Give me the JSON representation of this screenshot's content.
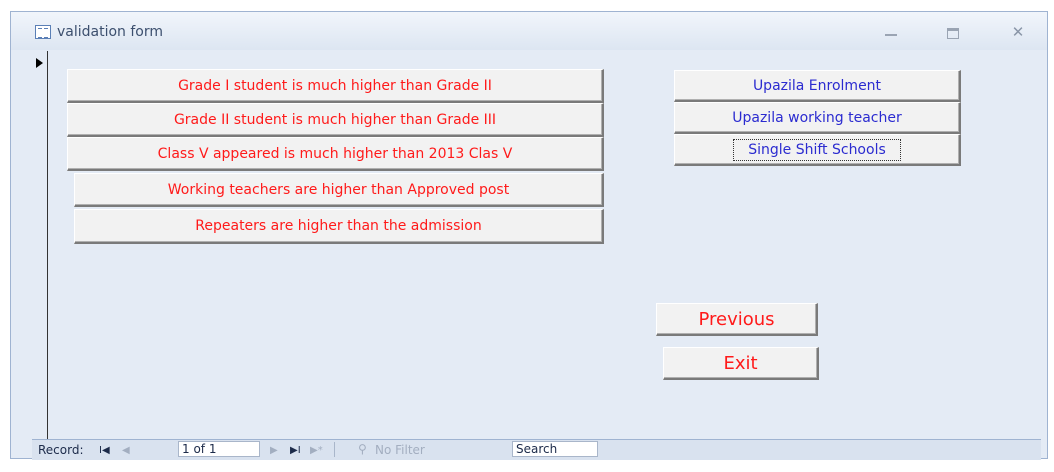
{
  "window": {
    "title": "validation form"
  },
  "left_buttons": [
    {
      "label": "Grade I student is much higher than Grade II"
    },
    {
      "label": "Grade II student is much higher than Grade III"
    },
    {
      "label": "Class V appeared is much higher than 2013 Clas V"
    },
    {
      "label": "Working teachers are higher than Approved post"
    },
    {
      "label": "Repeaters are higher than the admission"
    }
  ],
  "right_buttons": [
    {
      "label": "Upazila Enrolment"
    },
    {
      "label": "Upazila working teacher"
    },
    {
      "label": "Single Shift Schools"
    }
  ],
  "nav_buttons": {
    "previous": "Previous",
    "exit": "Exit"
  },
  "statusbar": {
    "record_label": "Record:",
    "first_glyph": "I◀",
    "prev_glyph": "◀",
    "record_value": "1 of 1",
    "next_glyph": "▶",
    "last_glyph": "▶I",
    "new_glyph": "▶*",
    "filter_label": "No Filter",
    "search_label": "Search"
  },
  "colors": {
    "red_text": "#ff1a1a",
    "blue_text": "#2b2bd0"
  },
  "icons": {
    "title_icon": "form-icon",
    "minimize": "minimize-icon",
    "restore": "restore-icon",
    "close": "close-icon",
    "record_selector": "record-selector-arrow-icon",
    "filter": "no-filter-icon"
  }
}
